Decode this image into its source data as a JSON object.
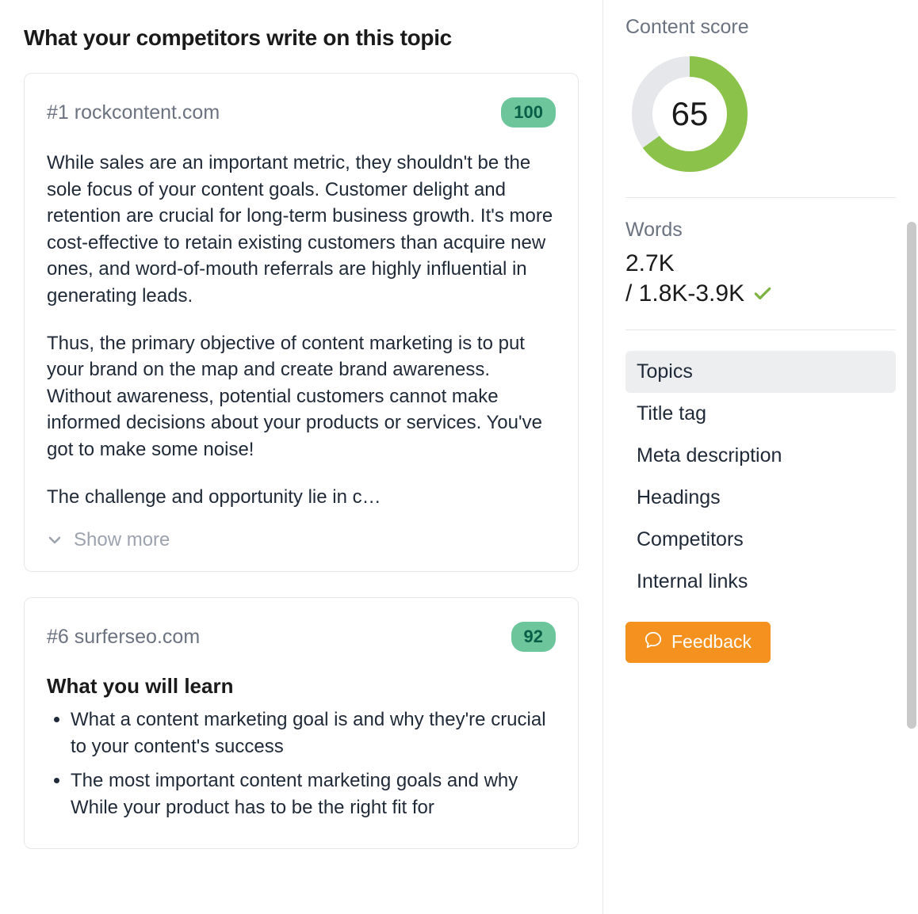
{
  "heading": "What your competitors write on this topic",
  "competitors": [
    {
      "rank_label": "#1 rockcontent.com",
      "score": "100",
      "paragraphs": [
        "While sales are an important metric, they shouldn't be the sole focus of your content goals. Customer delight and retention are crucial for long-term business growth. It's more cost-effective to retain existing customers than acquire new ones, and word-of-mouth referrals are highly influential in generating leads.",
        "Thus, the primary objective of content marketing is to put your brand on the map and create brand awareness. Without awareness, potential customers cannot make informed decisions about your products or services. You've got to make some noise!",
        "The challenge and opportunity lie in c…"
      ],
      "show_more_label": "Show more"
    },
    {
      "rank_label": "#6 surferseo.com",
      "score": "92",
      "subheading": "What you will learn",
      "bullets": [
        "What a content marketing goal is and why they're crucial to your content's success",
        "The most important content marketing goals and why While your product has to be the right fit for"
      ]
    }
  ],
  "sidebar": {
    "content_score_label": "Content score",
    "content_score_value": "65",
    "content_score_percent": 65,
    "words_label": "Words",
    "words_value": "2.7K",
    "words_range": "/ 1.8K-3.9K",
    "nav": [
      {
        "label": "Topics",
        "active": true
      },
      {
        "label": "Title tag",
        "active": false
      },
      {
        "label": "Meta description",
        "active": false
      },
      {
        "label": "Headings",
        "active": false
      },
      {
        "label": "Competitors",
        "active": false
      },
      {
        "label": "Internal links",
        "active": false
      }
    ],
    "feedback_label": "Feedback"
  },
  "colors": {
    "accent_green": "#8bc34a",
    "badge_green": "#6cc59b",
    "orange": "#f5911e",
    "muted": "#6b7280"
  },
  "chart_data": {
    "type": "pie",
    "title": "Content score",
    "values": [
      65,
      35
    ],
    "categories": [
      "score",
      "remaining"
    ],
    "ylim": [
      0,
      100
    ]
  }
}
